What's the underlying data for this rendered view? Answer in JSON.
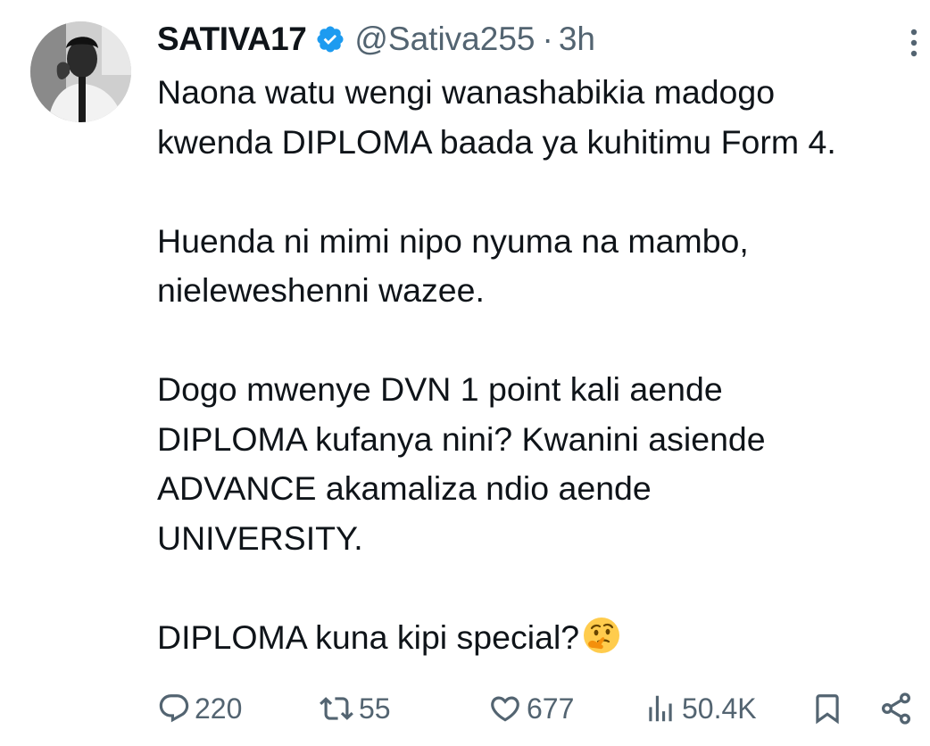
{
  "author": {
    "display_name": "SATIVA17",
    "handle": "@Sativa255",
    "separator": "·",
    "timestamp": "3h",
    "verified": true,
    "verified_color": "#1d9bf0"
  },
  "tweet": {
    "paragraphs": [
      [
        "Naona watu wengi wanashabikia madogo",
        "kwenda DIPLOMA baada ya kuhitimu Form 4."
      ],
      [
        "Huenda ni mimi nipo nyuma na mambo,",
        "nieleweshenni wazee."
      ],
      [
        "Dogo mwenye DVN 1 point kali aende",
        "DIPLOMA kufanya nini? Kwanini asiende",
        "ADVANCE akamaliza ndio aende",
        "UNIVERSITY."
      ],
      [
        "DIPLOMA kuna kipi special?"
      ]
    ],
    "emoji": "thinking-face"
  },
  "actions": {
    "replies": "220",
    "reposts": "55",
    "likes": "677",
    "views": "50.4K"
  },
  "colors": {
    "text": "#0f1419",
    "secondary": "#536471",
    "accent": "#1d9bf0"
  }
}
